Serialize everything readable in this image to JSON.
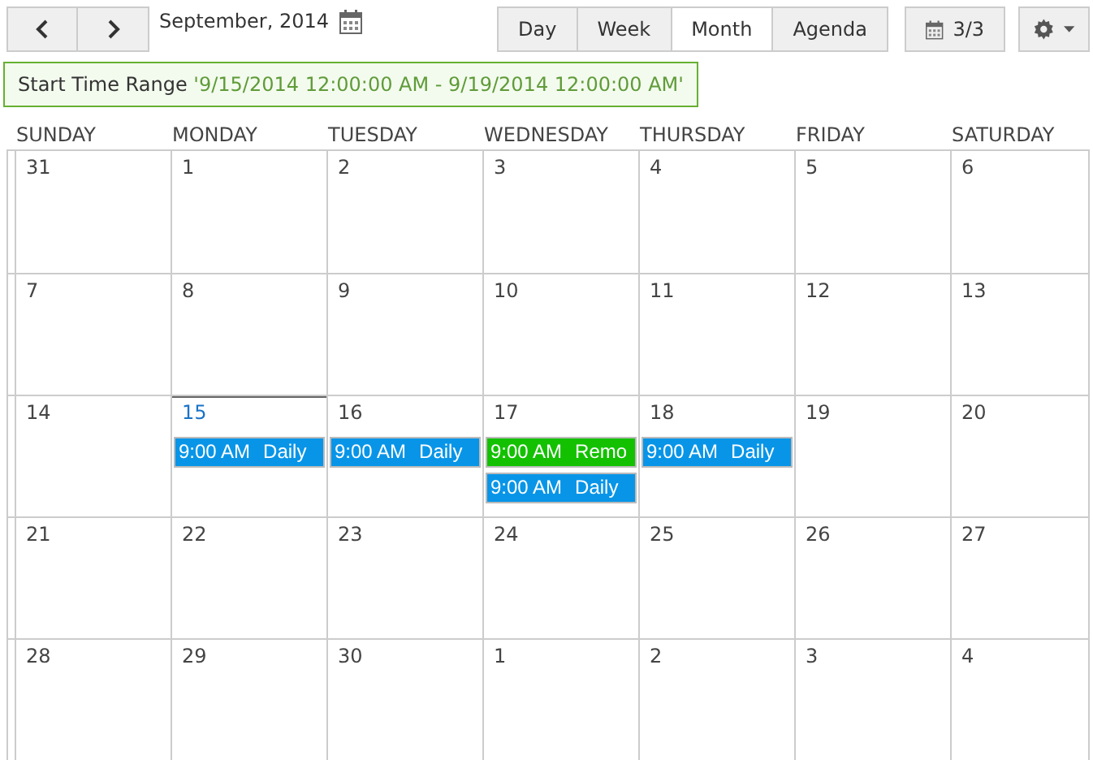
{
  "toolbar": {
    "title": "September, 2014",
    "views": [
      {
        "label": "Day",
        "selected": false
      },
      {
        "label": "Week",
        "selected": false
      },
      {
        "label": "Month",
        "selected": true
      },
      {
        "label": "Agenda",
        "selected": false
      }
    ],
    "calendars": "3/3"
  },
  "filter": {
    "label": "Start Time Range",
    "value": "'9/15/2014 12:00:00 AM - 9/19/2014 12:00:00 AM'"
  },
  "weekdays": [
    "SUNDAY",
    "MONDAY",
    "TUESDAY",
    "WEDNESDAY",
    "THURSDAY",
    "FRIDAY",
    "SATURDAY"
  ],
  "weeks": [
    [
      {
        "day": "31",
        "today": false
      },
      {
        "day": "1",
        "today": false
      },
      {
        "day": "2",
        "today": false
      },
      {
        "day": "3",
        "today": false
      },
      {
        "day": "4",
        "today": false
      },
      {
        "day": "5",
        "today": false
      },
      {
        "day": "6",
        "today": false
      }
    ],
    [
      {
        "day": "7",
        "today": false
      },
      {
        "day": "8",
        "today": false
      },
      {
        "day": "9",
        "today": false
      },
      {
        "day": "10",
        "today": false
      },
      {
        "day": "11",
        "today": false
      },
      {
        "day": "12",
        "today": false
      },
      {
        "day": "13",
        "today": false
      }
    ],
    [
      {
        "day": "14",
        "today": false
      },
      {
        "day": "15",
        "today": true,
        "events": [
          {
            "time": "9:00 AM",
            "title": "Daily",
            "color": "#0895e8"
          }
        ]
      },
      {
        "day": "16",
        "today": false,
        "events": [
          {
            "time": "9:00 AM",
            "title": "Daily",
            "color": "#0895e8"
          }
        ]
      },
      {
        "day": "17",
        "today": false,
        "events": [
          {
            "time": "9:00 AM",
            "title": "Remo",
            "color": "#13c100"
          },
          {
            "time": "9:00 AM",
            "title": "Daily",
            "color": "#0895e8"
          }
        ]
      },
      {
        "day": "18",
        "today": false,
        "events": [
          {
            "time": "9:00 AM",
            "title": "Daily",
            "color": "#0895e8"
          }
        ]
      },
      {
        "day": "19",
        "today": false
      },
      {
        "day": "20",
        "today": false
      }
    ],
    [
      {
        "day": "21",
        "today": false
      },
      {
        "day": "22",
        "today": false
      },
      {
        "day": "23",
        "today": false
      },
      {
        "day": "24",
        "today": false
      },
      {
        "day": "25",
        "today": false
      },
      {
        "day": "26",
        "today": false
      },
      {
        "day": "27",
        "today": false
      }
    ],
    [
      {
        "day": "28",
        "today": false
      },
      {
        "day": "29",
        "today": false
      },
      {
        "day": "30",
        "today": false
      },
      {
        "day": "1",
        "today": false
      },
      {
        "day": "2",
        "today": false
      },
      {
        "day": "3",
        "today": false
      },
      {
        "day": "4",
        "today": false
      }
    ]
  ]
}
